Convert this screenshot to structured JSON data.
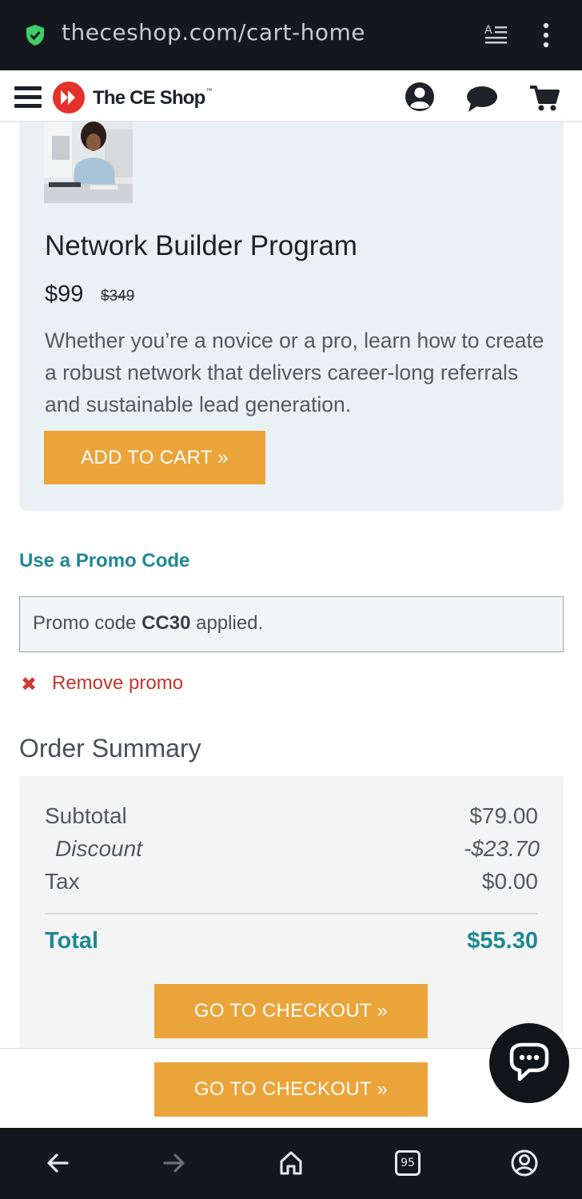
{
  "browser": {
    "url": "theceshop.com/cart-home",
    "icons": [
      "secure-shield-icon",
      "reader-mode-icon",
      "overflow-menu-icon"
    ]
  },
  "header": {
    "logo_text": "The CE Shop",
    "logo_tm": "™",
    "icons": [
      "hamburger-menu-icon",
      "account-icon",
      "chat-icon",
      "cart-icon"
    ]
  },
  "product": {
    "title": "Network Builder Program",
    "price": "$99",
    "old_price": "$349",
    "description": "Whether you’re a novice or a pro, learn how to create a robust network that delivers career-long referrals and sustainable lead generation.",
    "add_to_cart_label": "ADD TO CART »"
  },
  "promo": {
    "title": "Use a Promo Code",
    "applied_prefix": "Promo code ",
    "applied_code": "CC30",
    "applied_suffix": " applied.",
    "remove_icon": "✖",
    "remove_label": "Remove promo"
  },
  "summary": {
    "title": "Order Summary",
    "subtotal_label": "Subtotal",
    "subtotal_value": "$79.00",
    "discount_label": "Discount",
    "discount_value": "-$23.70",
    "tax_label": "Tax",
    "tax_value": "$0.00",
    "total_label": "Total",
    "total_value": "$55.30",
    "checkout_label": "GO TO CHECKOUT »"
  },
  "sticky": {
    "checkout_label": "GO TO CHECKOUT »"
  },
  "android_nav": {
    "tab_count": "95",
    "icons": [
      "back-arrow-icon",
      "forward-arrow-icon",
      "home-icon",
      "tabs-icon",
      "profile-icon"
    ]
  },
  "colors": {
    "accent_teal": "#1f8893",
    "button_orange": "#eba43a",
    "error_red": "#c9332b",
    "brand_red": "#e4312b"
  }
}
